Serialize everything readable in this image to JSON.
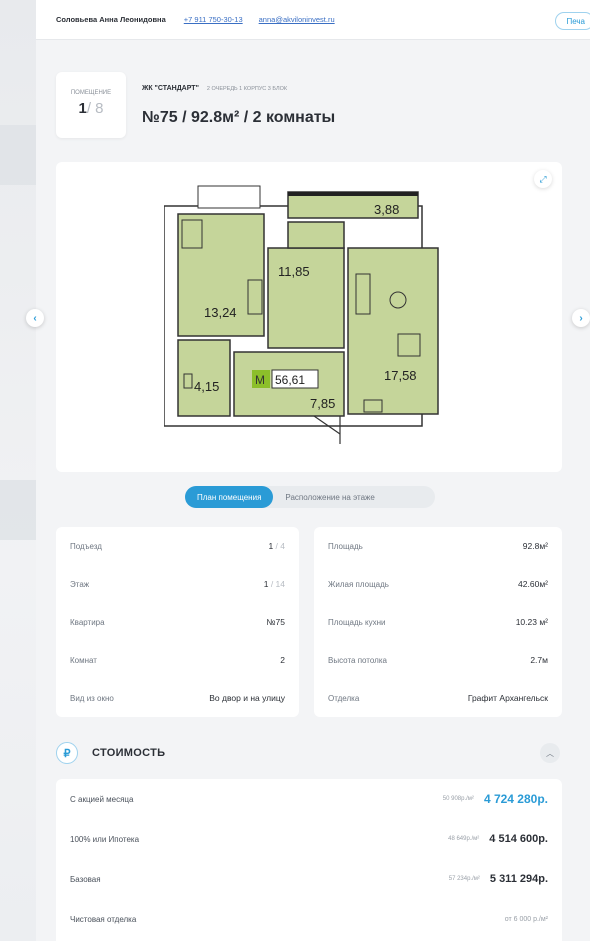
{
  "header": {
    "agent_name": "Соловьева Анна Леонидовна",
    "phone": "+7 911 750-30-13",
    "email": "anna@akviloninvest.ru",
    "print_label": "Печа"
  },
  "unit": {
    "label": "ПОМЕЩЕНИЕ",
    "current": "1",
    "total": "/ 8"
  },
  "project": {
    "name": "ЖК \"СТАНДАРТ\"",
    "sub": "2 ОЧЕРЕДЬ 1 КОРПУС 3 БЛОК",
    "title": "№75 / 92.8м² / 2 комнаты"
  },
  "plan": {
    "rooms": [
      "13,24",
      "11,85",
      "3,88",
      "17,58",
      "4,15",
      "7,85",
      "56,61"
    ],
    "m_label": "М"
  },
  "tabs": {
    "active": "План помещения",
    "inactive": "Расположение на этаже"
  },
  "details_left": [
    {
      "k": "Подъезд",
      "v": "1",
      "dim": " / 4"
    },
    {
      "k": "Этаж",
      "v": "1",
      "dim": " / 14"
    },
    {
      "k": "Квартира",
      "v": "№75",
      "dim": ""
    },
    {
      "k": "Комнат",
      "v": "2",
      "dim": ""
    },
    {
      "k": "Вид из окно",
      "v": "Во двор и на улицу",
      "dim": ""
    }
  ],
  "details_right": [
    {
      "k": "Площадь",
      "v": "92.8м²"
    },
    {
      "k": "Жилая площадь",
      "v": "42.60м²"
    },
    {
      "k": "Площадь кухни",
      "v": "10.23 м²"
    },
    {
      "k": "Высота потолка",
      "v": "2.7м"
    },
    {
      "k": "Отделка",
      "v": "Графит Архангельск"
    }
  ],
  "cost": {
    "title": "СТОИМОСТЬ",
    "ruble": "₽",
    "rows": [
      {
        "k": "С акцией месяца",
        "per": "50 908р./м²",
        "p": "4 724 280р."
      },
      {
        "k": "100% или Ипотека",
        "per": "48 649р./м²",
        "p": "4 514 600р."
      },
      {
        "k": "Базовая",
        "per": "57 234р./м²",
        "p": "5 311 294р."
      },
      {
        "k": "Чистовая отделка",
        "per": "",
        "p": "от 6 000 р./м²"
      }
    ]
  },
  "colors": {
    "accent": "#2a9bd6",
    "room_fill": "#c5d59a"
  }
}
